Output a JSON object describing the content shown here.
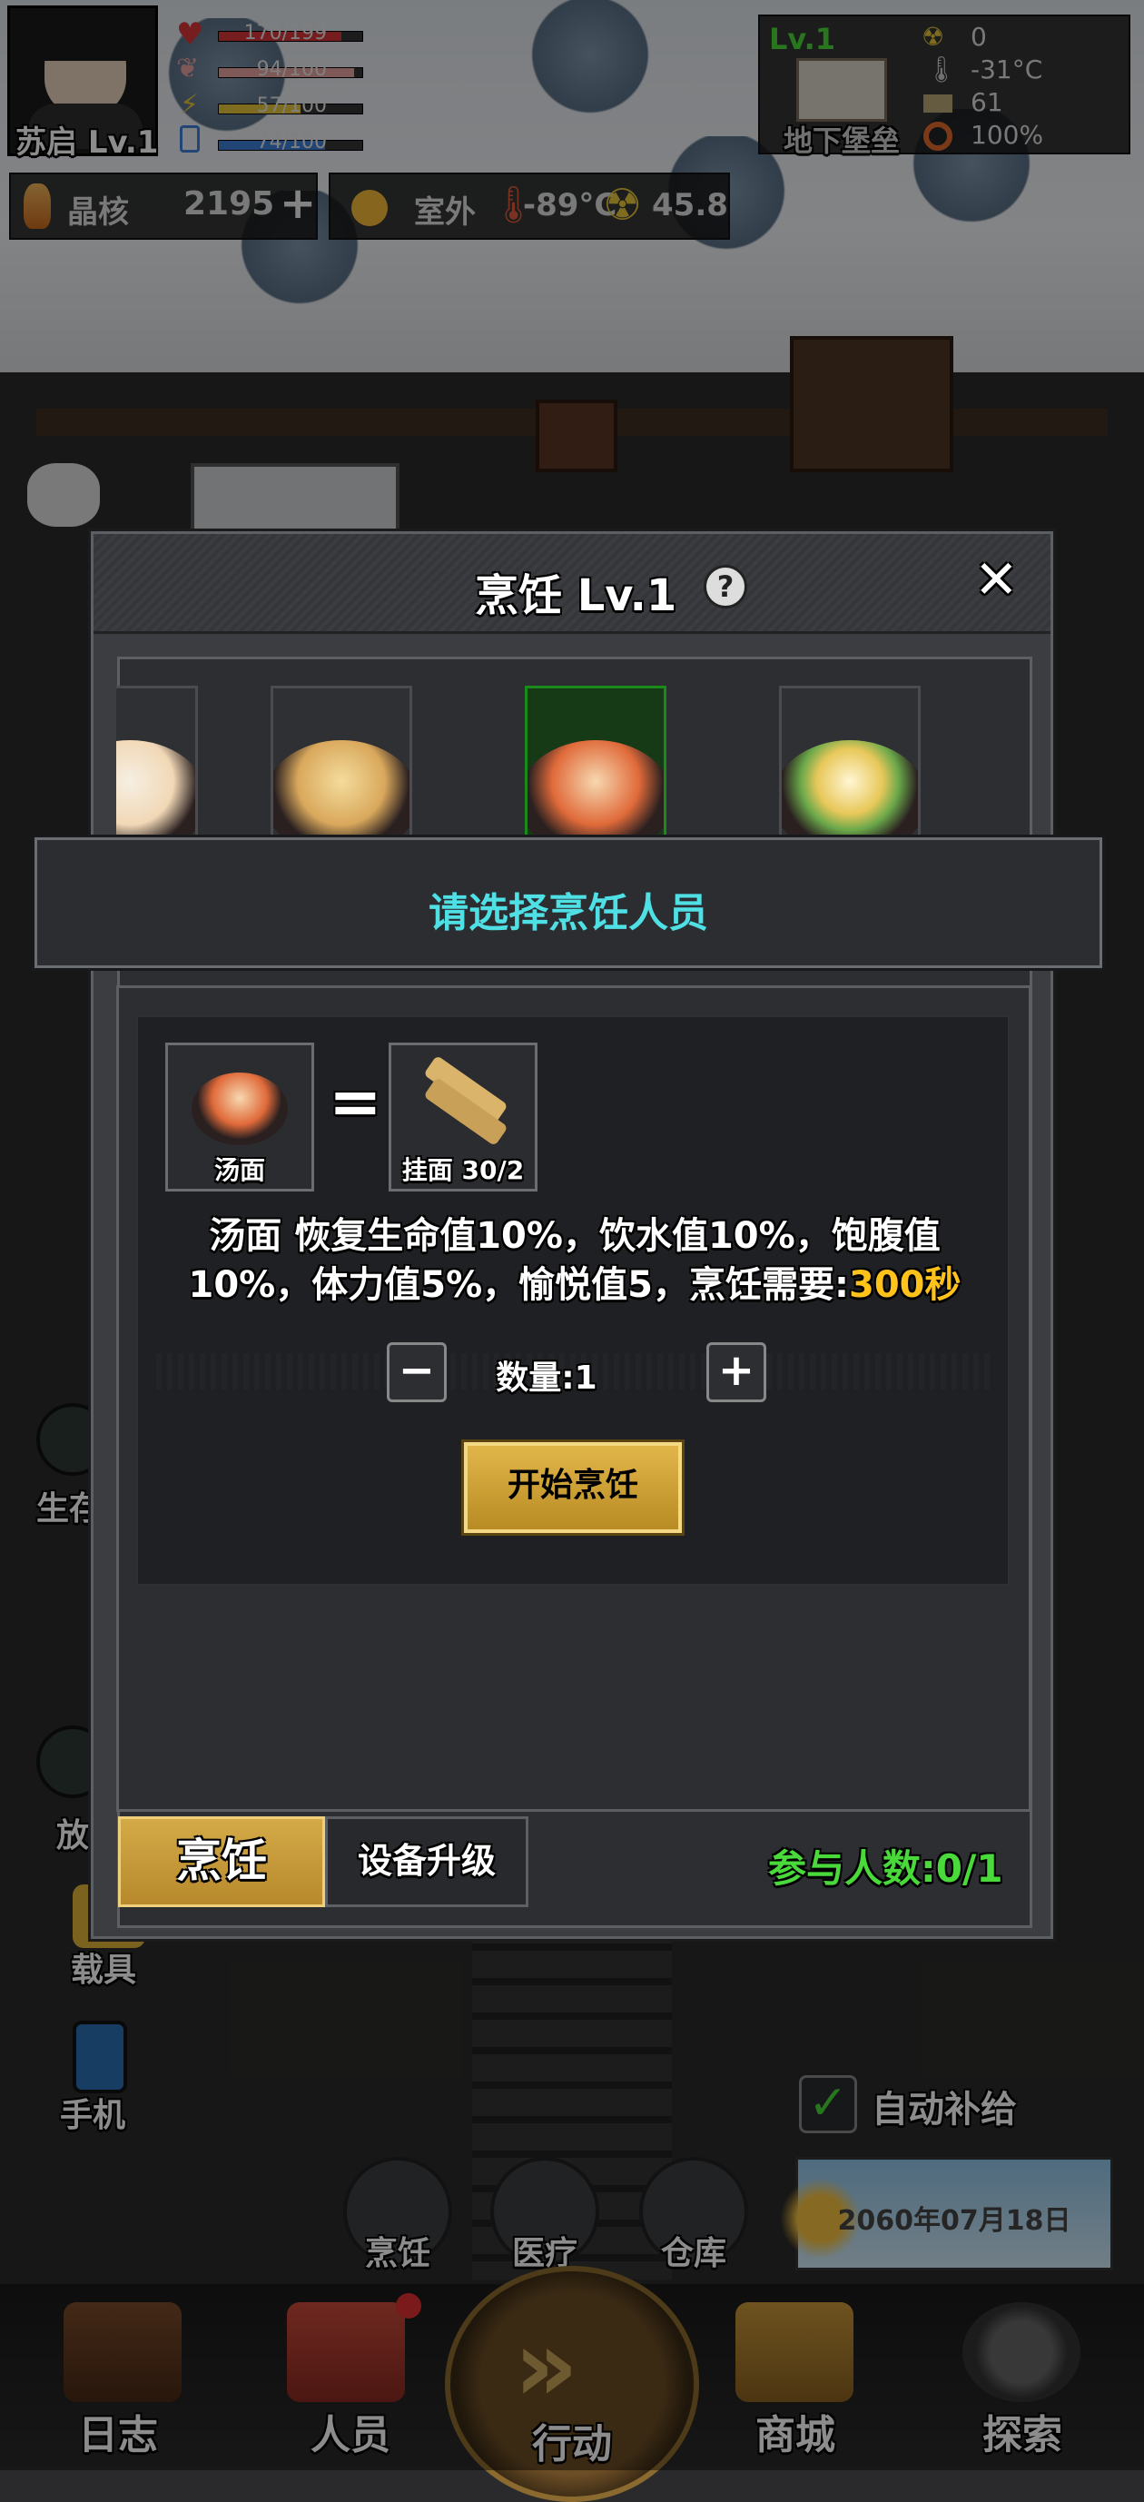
{
  "player": {
    "name_level": "苏启 Lv.1"
  },
  "stats": [
    {
      "label": "170/199",
      "color": "#d8373a",
      "fill": 0.854
    },
    {
      "label": "94/100",
      "color": "#e7a0a0",
      "fill": 0.94
    },
    {
      "label": "57/100",
      "color": "#e6c53b",
      "fill": 0.57
    },
    {
      "label": "74/100",
      "color": "#3d7fd6",
      "fill": 0.74
    }
  ],
  "currency": {
    "name": "晶核",
    "amount": "2195",
    "add": "+"
  },
  "weather": {
    "location": "室外",
    "temperature": "-89°C",
    "radiation": "45.8"
  },
  "base": {
    "level": "Lv.1",
    "name": "地下堡垒",
    "radiation": "0",
    "temperature": "-31°C",
    "supplies": "61",
    "power": "100%"
  },
  "dialog": {
    "title": "烹饪 Lv.1",
    "help": "?",
    "close": "✕",
    "banner": "请选择烹饪人员",
    "recipe": {
      "result_label": "汤面",
      "equals": "=",
      "ingredient_label": "挂面 30/2",
      "description_line1": "汤面 恢复生命值10%，饮水值10%，饱腹值",
      "description_line2": "10%，体力值5%，愉悦值5，烹饪需要:",
      "cook_time": "300秒",
      "quantity_label": "数量:1",
      "minus": "−",
      "plus": "+",
      "start_button": "开始烹饪"
    },
    "tabs": [
      {
        "label": "烹饪",
        "active": true
      },
      {
        "label": "设备升级",
        "active": false
      }
    ],
    "participants": "参与人数:0/1"
  },
  "side": {
    "vehicle": "载具",
    "phone": "手机",
    "auto_supply": "自动补给",
    "date": "2060年07月18日",
    "partial1": "生存",
    "partial2": "放"
  },
  "rooms": [
    {
      "label": "烹饪"
    },
    {
      "label": "医疗"
    },
    {
      "label": "仓库"
    }
  ],
  "nav": [
    {
      "label": "日志"
    },
    {
      "label": "人员"
    },
    {
      "label": "行动"
    },
    {
      "label": "商城"
    },
    {
      "label": "探索"
    }
  ],
  "colors": {
    "accent_green": "#4ad93a",
    "banner_cyan": "#4fe0e6",
    "gold": "#ffc21a"
  }
}
